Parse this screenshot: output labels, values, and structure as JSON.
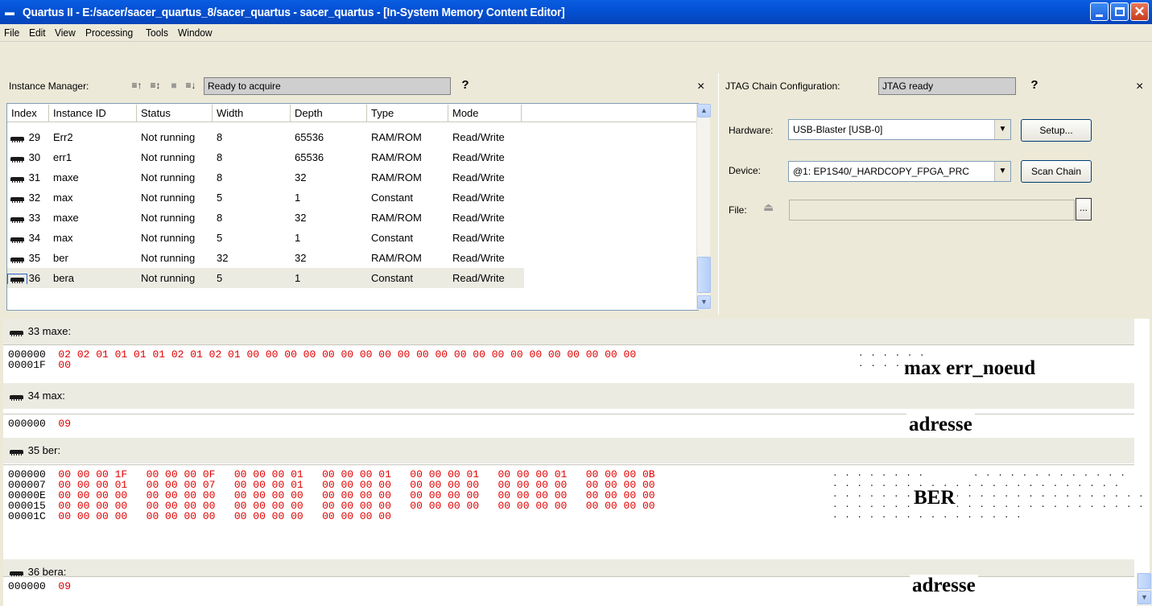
{
  "window": {
    "title": "Quartus II - E:/sacer/sacer_quartus_8/sacer_quartus - sacer_quartus - [In-System Memory Content Editor]",
    "close_glyph": "✕"
  },
  "menu": [
    "File",
    "Edit",
    "View",
    "Processing",
    "Tools",
    "Window"
  ],
  "instance_manager": {
    "label": "Instance Manager:",
    "status": "Ready to acquire",
    "help": "?",
    "close": "×",
    "columns": [
      "Index",
      "Instance ID",
      "Status",
      "Width",
      "Depth",
      "Type",
      "Mode"
    ],
    "rows": [
      {
        "index": "29",
        "id": "Err2",
        "status": "Not running",
        "width": "8",
        "depth": "65536",
        "type": "RAM/ROM",
        "mode": "Read/Write"
      },
      {
        "index": "30",
        "id": "err1",
        "status": "Not running",
        "width": "8",
        "depth": "65536",
        "type": "RAM/ROM",
        "mode": "Read/Write"
      },
      {
        "index": "31",
        "id": "maxe",
        "status": "Not running",
        "width": "8",
        "depth": "32",
        "type": "RAM/ROM",
        "mode": "Read/Write"
      },
      {
        "index": "32",
        "id": "max",
        "status": "Not running",
        "width": "5",
        "depth": "1",
        "type": "Constant",
        "mode": "Read/Write"
      },
      {
        "index": "33",
        "id": "maxe",
        "status": "Not running",
        "width": "8",
        "depth": "32",
        "type": "RAM/ROM",
        "mode": "Read/Write"
      },
      {
        "index": "34",
        "id": "max",
        "status": "Not running",
        "width": "5",
        "depth": "1",
        "type": "Constant",
        "mode": "Read/Write"
      },
      {
        "index": "35",
        "id": "ber",
        "status": "Not running",
        "width": "32",
        "depth": "32",
        "type": "RAM/ROM",
        "mode": "Read/Write"
      },
      {
        "index": "36",
        "id": "bera",
        "status": "Not running",
        "width": "5",
        "depth": "1",
        "type": "Constant",
        "mode": "Read/Write"
      }
    ],
    "selected_row": 7
  },
  "jtag": {
    "label": "JTAG Chain Configuration:",
    "status": "JTAG ready",
    "help": "?",
    "close": "×",
    "hardware_label": "Hardware:",
    "hardware_value": "USB-Blaster [USB-0]",
    "device_label": "Device:",
    "device_value": "@1: EP1S40/_HARDCOPY_FPGA_PRC",
    "file_label": "File:",
    "file_value": "",
    "setup_label": "Setup...",
    "scan_label": "Scan Chain",
    "browse_label": "..."
  },
  "memory": {
    "sections": [
      {
        "title": "33  maxe:",
        "lines": [
          {
            "addr": "000000",
            "hex": "02 02 01 01 01 01 02 01 02 01 00 00 00 00 00 00 00 00 00 00 00 00 00 00 00 00 00 00 00 00 00"
          },
          {
            "addr": "00001F",
            "hex": "00"
          }
        ],
        "ascii": [
          ". . . . . .  ",
          ". . . . ."
        ],
        "overlay": "max err_noeud"
      },
      {
        "title": "34  max:",
        "lines": [
          {
            "addr": "000000",
            "hex": "09"
          }
        ],
        "overlay": "adresse"
      },
      {
        "title": "35  ber:",
        "lines": [
          {
            "addr": "000000",
            "hex": "00 00 00 1F   00 00 00 0F   00 00 00 01   00 00 00 01   00 00 00 01   00 00 00 01   00 00 00 0B"
          },
          {
            "addr": "000007",
            "hex": "00 00 00 01   00 00 00 07   00 00 00 01   00 00 00 00   00 00 00 00   00 00 00 00   00 00 00 00"
          },
          {
            "addr": "00000E",
            "hex": "00 00 00 00   00 00 00 00   00 00 00 00   00 00 00 00   00 00 00 00   00 00 00 00   00 00 00 00"
          },
          {
            "addr": "000015",
            "hex": "00 00 00 00   00 00 00 00   00 00 00 00   00 00 00 00   00 00 00 00   00 00 00 00   00 00 00 00"
          },
          {
            "addr": "00001C",
            "hex": "00 00 00 00   00 00 00 00   00 00 00 00   00 00 00 00"
          }
        ],
        "ascii_lines": [
          ". . . . . . . .        . . . . . . . . . . . . .",
          ". . . . . . . . . . . . . . . . . . . . . . . .",
          ". . . . . . . . . . . . . . . . . . . . . . . . . . . .",
          ". . . . . . . . . . . . . . . . . . . . . . . . . . . .",
          ". . . . . . . . . . . . . . . ."
        ],
        "overlay": "BER"
      },
      {
        "title": "36  bera:",
        "lines": [
          {
            "addr": "000000",
            "hex": "09"
          }
        ],
        "overlay": "adresse"
      }
    ]
  }
}
